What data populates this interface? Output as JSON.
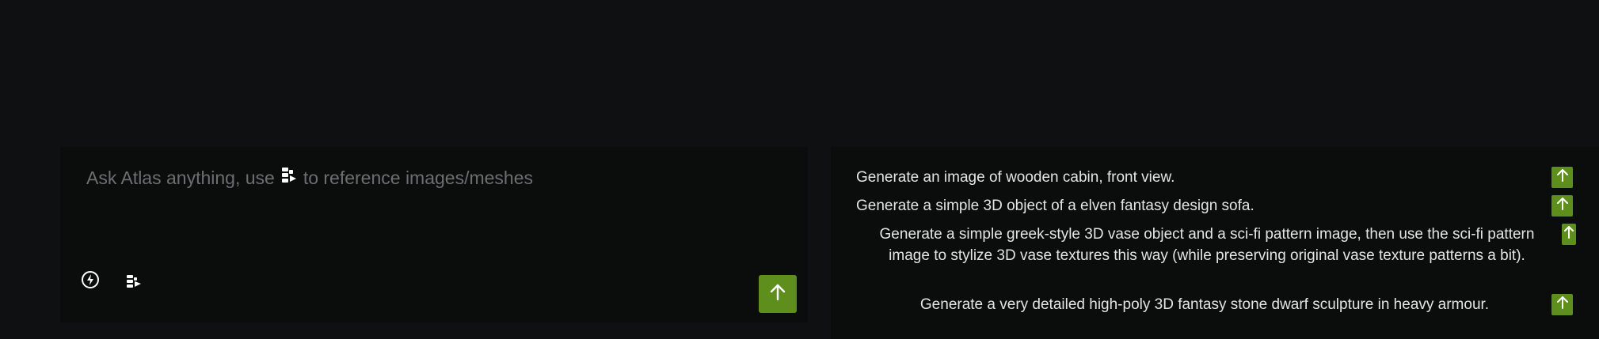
{
  "chat": {
    "placeholder_before": "Ask Atlas anything, use",
    "placeholder_after": "to reference images/meshes",
    "tools": {
      "mode_icon": "lightning-circle-icon",
      "reference_icon": "image-mesh-reference-icon"
    },
    "send_icon": "arrow-up-icon"
  },
  "suggestions": [
    {
      "text": "Generate an image of wooden cabin, front view."
    },
    {
      "text": "Generate a simple 3D object of a elven fantasy design sofa."
    },
    {
      "text": "Generate a simple greek-style 3D vase object and a sci-fi pattern image, then use the sci-fi pattern image to stylize 3D vase textures this way (while preserving original vase texture patterns a bit)."
    },
    {
      "text": "Generate a very detailed high-poly 3D fantasy stone dwarf sculpture in heavy armour."
    }
  ],
  "colors": {
    "background": "#0e1011",
    "panel": "#0b0d0d",
    "accent": "#5e8f1d",
    "placeholder": "#6c6f70",
    "text": "#e4e4e4"
  }
}
